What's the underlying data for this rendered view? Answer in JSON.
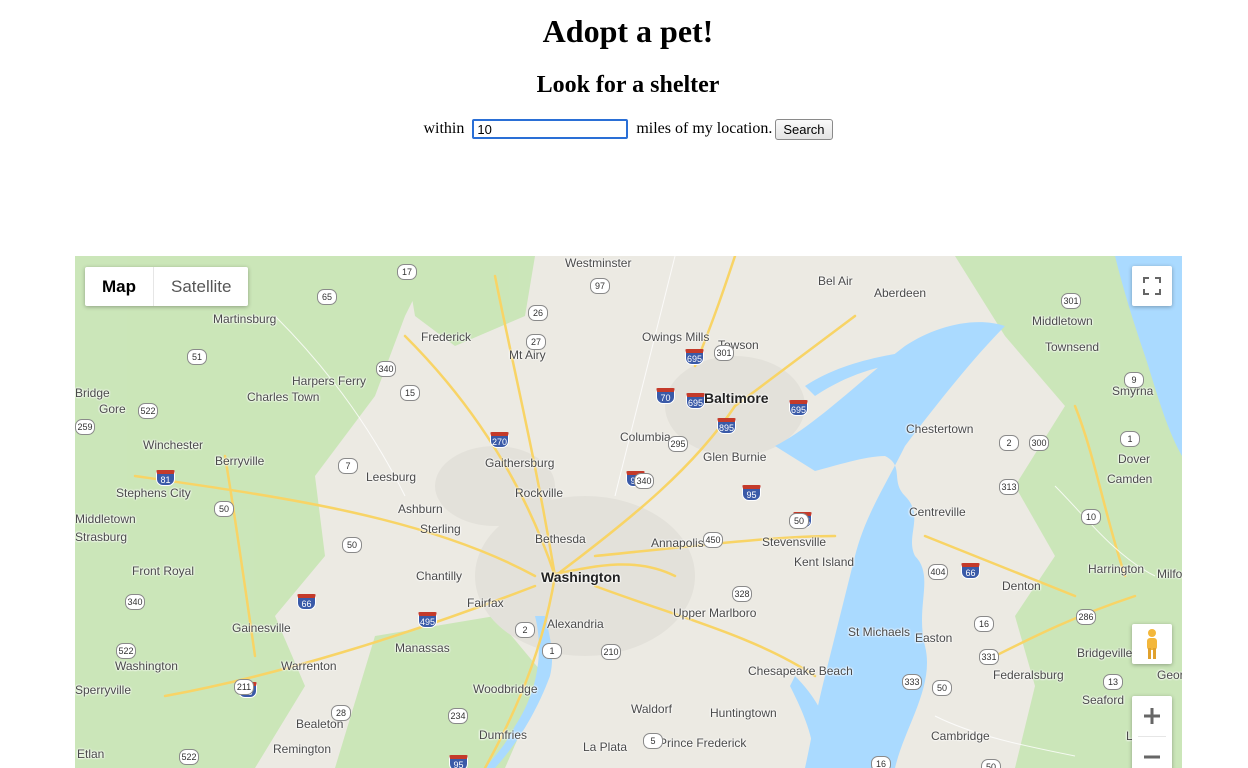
{
  "page": {
    "title": "Adopt a pet!",
    "subtitle": "Look for a shelter"
  },
  "search": {
    "prefix": "within ",
    "value": "10",
    "suffix": " miles of my location.",
    "button_label": "Search"
  },
  "map": {
    "type_options": [
      "Map",
      "Satellite"
    ],
    "active_type": "Map",
    "cities": [
      "Baltimore",
      "Washington"
    ],
    "towns": [
      "Westminster",
      "Bel Air",
      "Aberdeen",
      "Martinsburg",
      "Frederick",
      "Owings Mills",
      "Towson",
      "Middletown",
      "Townsend",
      "Mt Airy",
      "Harpers Ferry",
      "Charles Town",
      "Bridge",
      "Gore",
      "Smyrna",
      "Winchester",
      "Berryville",
      "Columbia",
      "Chestertown",
      "Gaithersburg",
      "Glen Burnie",
      "Dover",
      "Stephens City",
      "Leesburg",
      "Rockville",
      "Camden",
      "Middletown",
      "Ashburn",
      "Centreville",
      "Strasburg",
      "Sterling",
      "Bethesda",
      "Annapolis",
      "Stevensville",
      "Front Royal",
      "Chantilly",
      "Kent Island",
      "Harrington",
      "Milfor",
      "Denton",
      "Fairfax",
      "Alexandria",
      "Upper Marlboro",
      "Gainesville",
      "Manassas",
      "St Michaels",
      "Easton",
      "Washington",
      "Warrenton",
      "Bridgeville",
      "Chesapeake Beach",
      "Federalsburg",
      "Sperryville",
      "Woodbridge",
      "Seaford",
      "Bealeton",
      "Waldorf",
      "Huntingtown",
      "Remington",
      "Dumfries",
      "Cambridge",
      "Laure",
      "Etlan",
      "La Plata",
      "Prince Frederick",
      "Georg"
    ],
    "route_shields": [
      "17",
      "65",
      "97",
      "26",
      "27",
      "51",
      "340",
      "15",
      "70",
      "695",
      "95",
      "301",
      "9",
      "522",
      "259",
      "270",
      "895",
      "295",
      "81",
      "7",
      "340",
      "95",
      "2",
      "300",
      "1",
      "313",
      "50",
      "10",
      "50",
      "495",
      "450",
      "50",
      "404",
      "66",
      "66",
      "495",
      "2",
      "328",
      "16",
      "286",
      "95",
      "1",
      "210",
      "331",
      "211",
      "333",
      "50",
      "13",
      "28",
      "234",
      "5",
      "522",
      "95",
      "16",
      "50",
      "695",
      "695",
      "301",
      "522",
      "340"
    ],
    "icons": {
      "fullscreen": "fullscreen-icon",
      "pegman": "pegman-icon",
      "zoom_in": "plus-icon",
      "zoom_out": "minus-icon"
    },
    "colors": {
      "water": "#aadaff",
      "land": "#eceae3",
      "park": "#c8e6b4",
      "road": "#f8d466",
      "urban": "#e3e1da"
    }
  }
}
